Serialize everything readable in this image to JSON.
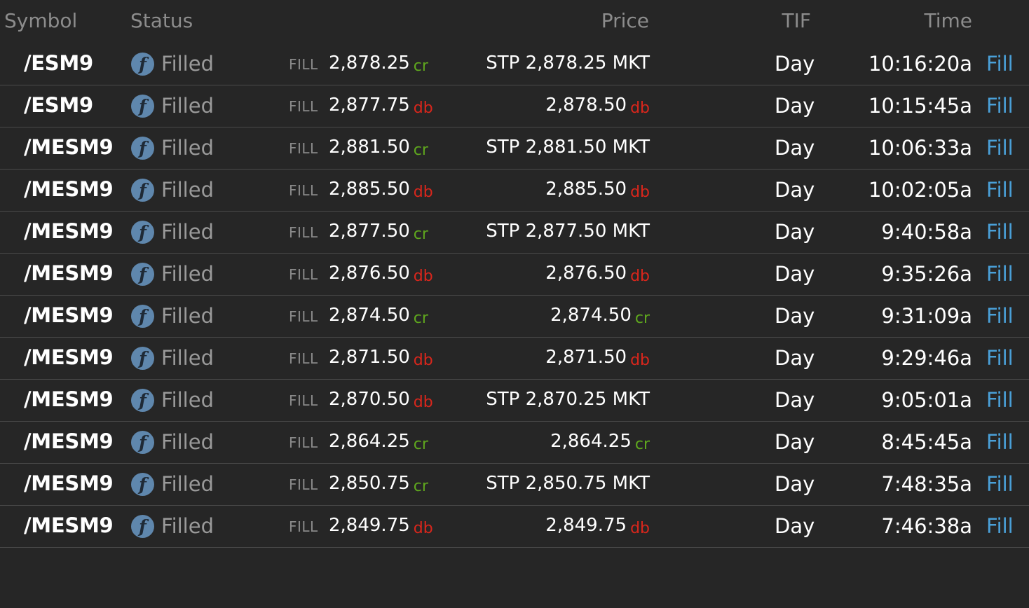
{
  "header": {
    "symbol": "Symbol",
    "status": "Status",
    "price": "Price",
    "tif": "TIF",
    "time": "Time"
  },
  "colors": {
    "background": "#262626",
    "credit": "#5fa81e",
    "debit": "#d9261c",
    "link": "#4aa0d8",
    "status_icon": "#5f87ad"
  },
  "icons": {
    "status": "filled-f-icon"
  },
  "rows": [
    {
      "symbol": "/ESM9",
      "icon_letter": "f",
      "status": "Filled",
      "fill_label": "FILL",
      "fill_price": "2,878.25",
      "fill_tag": "cr",
      "price": "STP 2,878.25 MKT",
      "price_tag": "",
      "tif": "Day",
      "time": "10:16:20a",
      "link": "Fill"
    },
    {
      "symbol": "/ESM9",
      "icon_letter": "f",
      "status": "Filled",
      "fill_label": "FILL",
      "fill_price": "2,877.75",
      "fill_tag": "db",
      "price": "2,878.50",
      "price_tag": "db",
      "tif": "Day",
      "time": "10:15:45a",
      "link": "Fill"
    },
    {
      "symbol": "/MESM9",
      "icon_letter": "f",
      "status": "Filled",
      "fill_label": "FILL",
      "fill_price": "2,881.50",
      "fill_tag": "cr",
      "price": "STP 2,881.50 MKT",
      "price_tag": "",
      "tif": "Day",
      "time": "10:06:33a",
      "link": "Fill"
    },
    {
      "symbol": "/MESM9",
      "icon_letter": "f",
      "status": "Filled",
      "fill_label": "FILL",
      "fill_price": "2,885.50",
      "fill_tag": "db",
      "price": "2,885.50",
      "price_tag": "db",
      "tif": "Day",
      "time": "10:02:05a",
      "link": "Fill"
    },
    {
      "symbol": "/MESM9",
      "icon_letter": "f",
      "status": "Filled",
      "fill_label": "FILL",
      "fill_price": "2,877.50",
      "fill_tag": "cr",
      "price": "STP 2,877.50 MKT",
      "price_tag": "",
      "tif": "Day",
      "time": "9:40:58a",
      "link": "Fill"
    },
    {
      "symbol": "/MESM9",
      "icon_letter": "f",
      "status": "Filled",
      "fill_label": "FILL",
      "fill_price": "2,876.50",
      "fill_tag": "db",
      "price": "2,876.50",
      "price_tag": "db",
      "tif": "Day",
      "time": "9:35:26a",
      "link": "Fill"
    },
    {
      "symbol": "/MESM9",
      "icon_letter": "f",
      "status": "Filled",
      "fill_label": "FILL",
      "fill_price": "2,874.50",
      "fill_tag": "cr",
      "price": "2,874.50",
      "price_tag": "cr",
      "tif": "Day",
      "time": "9:31:09a",
      "link": "Fill"
    },
    {
      "symbol": "/MESM9",
      "icon_letter": "f",
      "status": "Filled",
      "fill_label": "FILL",
      "fill_price": "2,871.50",
      "fill_tag": "db",
      "price": "2,871.50",
      "price_tag": "db",
      "tif": "Day",
      "time": "9:29:46a",
      "link": "Fill"
    },
    {
      "symbol": "/MESM9",
      "icon_letter": "f",
      "status": "Filled",
      "fill_label": "FILL",
      "fill_price": "2,870.50",
      "fill_tag": "db",
      "price": "STP 2,870.25 MKT",
      "price_tag": "",
      "tif": "Day",
      "time": "9:05:01a",
      "link": "Fill"
    },
    {
      "symbol": "/MESM9",
      "icon_letter": "f",
      "status": "Filled",
      "fill_label": "FILL",
      "fill_price": "2,864.25",
      "fill_tag": "cr",
      "price": "2,864.25",
      "price_tag": "cr",
      "tif": "Day",
      "time": "8:45:45a",
      "link": "Fill"
    },
    {
      "symbol": "/MESM9",
      "icon_letter": "f",
      "status": "Filled",
      "fill_label": "FILL",
      "fill_price": "2,850.75",
      "fill_tag": "cr",
      "price": "STP 2,850.75 MKT",
      "price_tag": "",
      "tif": "Day",
      "time": "7:48:35a",
      "link": "Fill"
    },
    {
      "symbol": "/MESM9",
      "icon_letter": "f",
      "status": "Filled",
      "fill_label": "FILL",
      "fill_price": "2,849.75",
      "fill_tag": "db",
      "price": "2,849.75",
      "price_tag": "db",
      "tif": "Day",
      "time": "7:46:38a",
      "link": "Fill"
    }
  ]
}
